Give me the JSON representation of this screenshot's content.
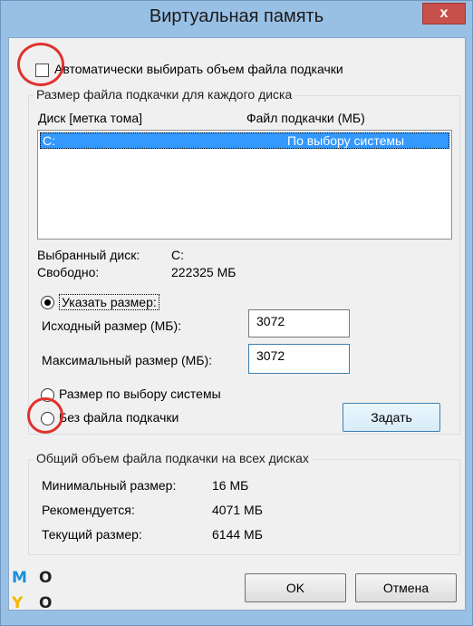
{
  "window": {
    "title": "Виртуальная память",
    "close_label": "x"
  },
  "auto_checkbox": {
    "label": "Автоматически выбирать объем файла подкачки",
    "checked": false
  },
  "per_drive_group": {
    "caption": "Размер файла подкачки для каждого диска",
    "columns": [
      "Диск [метка тома]",
      "Файл подкачки (МБ)"
    ],
    "rows": [
      {
        "drive": "C:",
        "paging": "По выбору системы",
        "selected": true
      }
    ],
    "selected_drive_label": "Выбранный диск:",
    "selected_drive_value": "C:",
    "free_label": "Свободно:",
    "free_value": "222325 МБ",
    "custom_size_label": "Указать размер:",
    "initial_size_label": "Исходный размер (МБ):",
    "initial_size_value": "3072",
    "max_size_label": "Максимальный размер (МБ):",
    "max_size_value": "3072",
    "system_managed_label": "Размер по выбору системы",
    "no_paging_label": "Без файла подкачки",
    "set_button": "Задать"
  },
  "total_group": {
    "caption": "Общий объем файла подкачки на всех дисках",
    "min_label": "Минимальный размер:",
    "min_value": "16 МБ",
    "recommended_label": "Рекомендуется:",
    "recommended_value": "4071 МБ",
    "current_label": "Текущий размер:",
    "current_value": "6144 МБ"
  },
  "footer": {
    "ok": "OK",
    "cancel": "Отмена"
  },
  "watermark": {
    "letters": [
      "M",
      "O",
      "Y",
      "O"
    ]
  },
  "colors": {
    "frame": "#98bfe4",
    "selection": "#3399ff",
    "highlight_circle": "#e0322f"
  }
}
